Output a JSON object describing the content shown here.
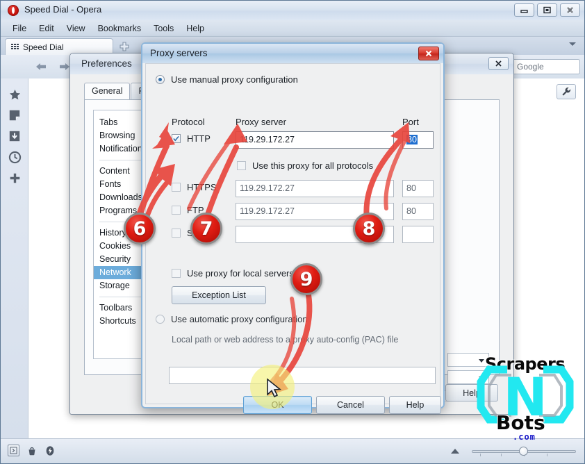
{
  "window": {
    "title": "Speed Dial - Opera",
    "logo_icon": "opera-logo-icon",
    "controls": {
      "minimize_icon": "minimize-icon",
      "maximize_icon": "maximize-icon",
      "close_icon": "close-icon"
    }
  },
  "menubar": {
    "items": [
      {
        "label": "File"
      },
      {
        "label": "Edit"
      },
      {
        "label": "View"
      },
      {
        "label": "Bookmarks"
      },
      {
        "label": "Tools"
      },
      {
        "label": "Help"
      }
    ]
  },
  "tabstrip": {
    "tab_label": "Speed Dial",
    "tab_icon": "speed-dial-grid-icon",
    "new_tab_icon": "plus-icon",
    "list_chevron_icon": "chevron-down-icon"
  },
  "navbar": {
    "back_icon": "arrow-left-icon",
    "forward_icon": "arrow-right-icon",
    "search_value": "Google"
  },
  "sidepanel": {
    "items": [
      {
        "icon": "bookmarks-star-icon"
      },
      {
        "icon": "notes-icon"
      },
      {
        "icon": "downloads-icon"
      },
      {
        "icon": "history-clock-icon"
      },
      {
        "icon": "add-panel-plus-icon"
      }
    ]
  },
  "content": {
    "wrench_icon": "wrench-icon"
  },
  "statusbar": {
    "panel_toggle_icon": "panel-toggle-icon",
    "trash_icon": "trash-icon",
    "turbo_icon": "opera-turbo-icon",
    "zoom_up_icon": "triangle-up-icon",
    "zoom_value": "100"
  },
  "preferences": {
    "title": "Preferences",
    "close_icon": "close-icon",
    "tabs": [
      {
        "label": "General",
        "active": true
      },
      {
        "label": "Form",
        "active": false
      }
    ],
    "list_groups": [
      [
        "Tabs",
        "Browsing",
        "Notifications"
      ],
      [
        "Content",
        "Fonts",
        "Downloads",
        "Programs"
      ],
      [
        "History",
        "Cookies",
        "Security",
        "Network",
        "Storage"
      ],
      [
        "Toolbars",
        "Shortcuts"
      ]
    ],
    "selected_item": "Network",
    "help_label": "Help"
  },
  "proxy_dialog": {
    "title": "Proxy servers",
    "close_icon": "close-icon",
    "manual_option": {
      "label": "Use manual proxy configuration",
      "selected": true
    },
    "column_headers": {
      "protocol": "Protocol",
      "server": "Proxy server",
      "port": "Port"
    },
    "rows": [
      {
        "protocol": "HTTP",
        "checked": true,
        "server": "119.29.172.27",
        "port": "80",
        "port_selected": true,
        "enabled": true
      },
      {
        "protocol": "HTTPS",
        "checked": false,
        "server": "119.29.172.27",
        "port": "80",
        "port_selected": false,
        "enabled": false
      },
      {
        "protocol": "FTP",
        "checked": false,
        "server": "119.29.172.27",
        "port": "80",
        "port_selected": false,
        "enabled": false
      },
      {
        "protocol": "SOCKS",
        "checked": false,
        "server": "",
        "port": "",
        "port_selected": false,
        "enabled": false
      }
    ],
    "use_all_protocols": {
      "label": "Use this proxy for all protocols",
      "checked": false
    },
    "use_local_servers": {
      "label": "Use proxy for local servers",
      "checked": false
    },
    "exception_list_label": "Exception List",
    "automatic_option": {
      "label": "Use automatic proxy configuration",
      "selected": false
    },
    "pac_hint": "Local path or web address to a proxy auto-config (PAC) file",
    "pac_value": "",
    "buttons": {
      "ok": "OK",
      "cancel": "Cancel",
      "help": "Help"
    }
  },
  "annotations": {
    "badges": [
      {
        "number": "6"
      },
      {
        "number": "7"
      },
      {
        "number": "8"
      },
      {
        "number": "9"
      }
    ]
  },
  "watermark": {
    "top_text": "Scrapers",
    "bottom_text": "Bots",
    "domain_text": ".com",
    "logo_letter": "N",
    "accent_color": "#22e8f0"
  }
}
